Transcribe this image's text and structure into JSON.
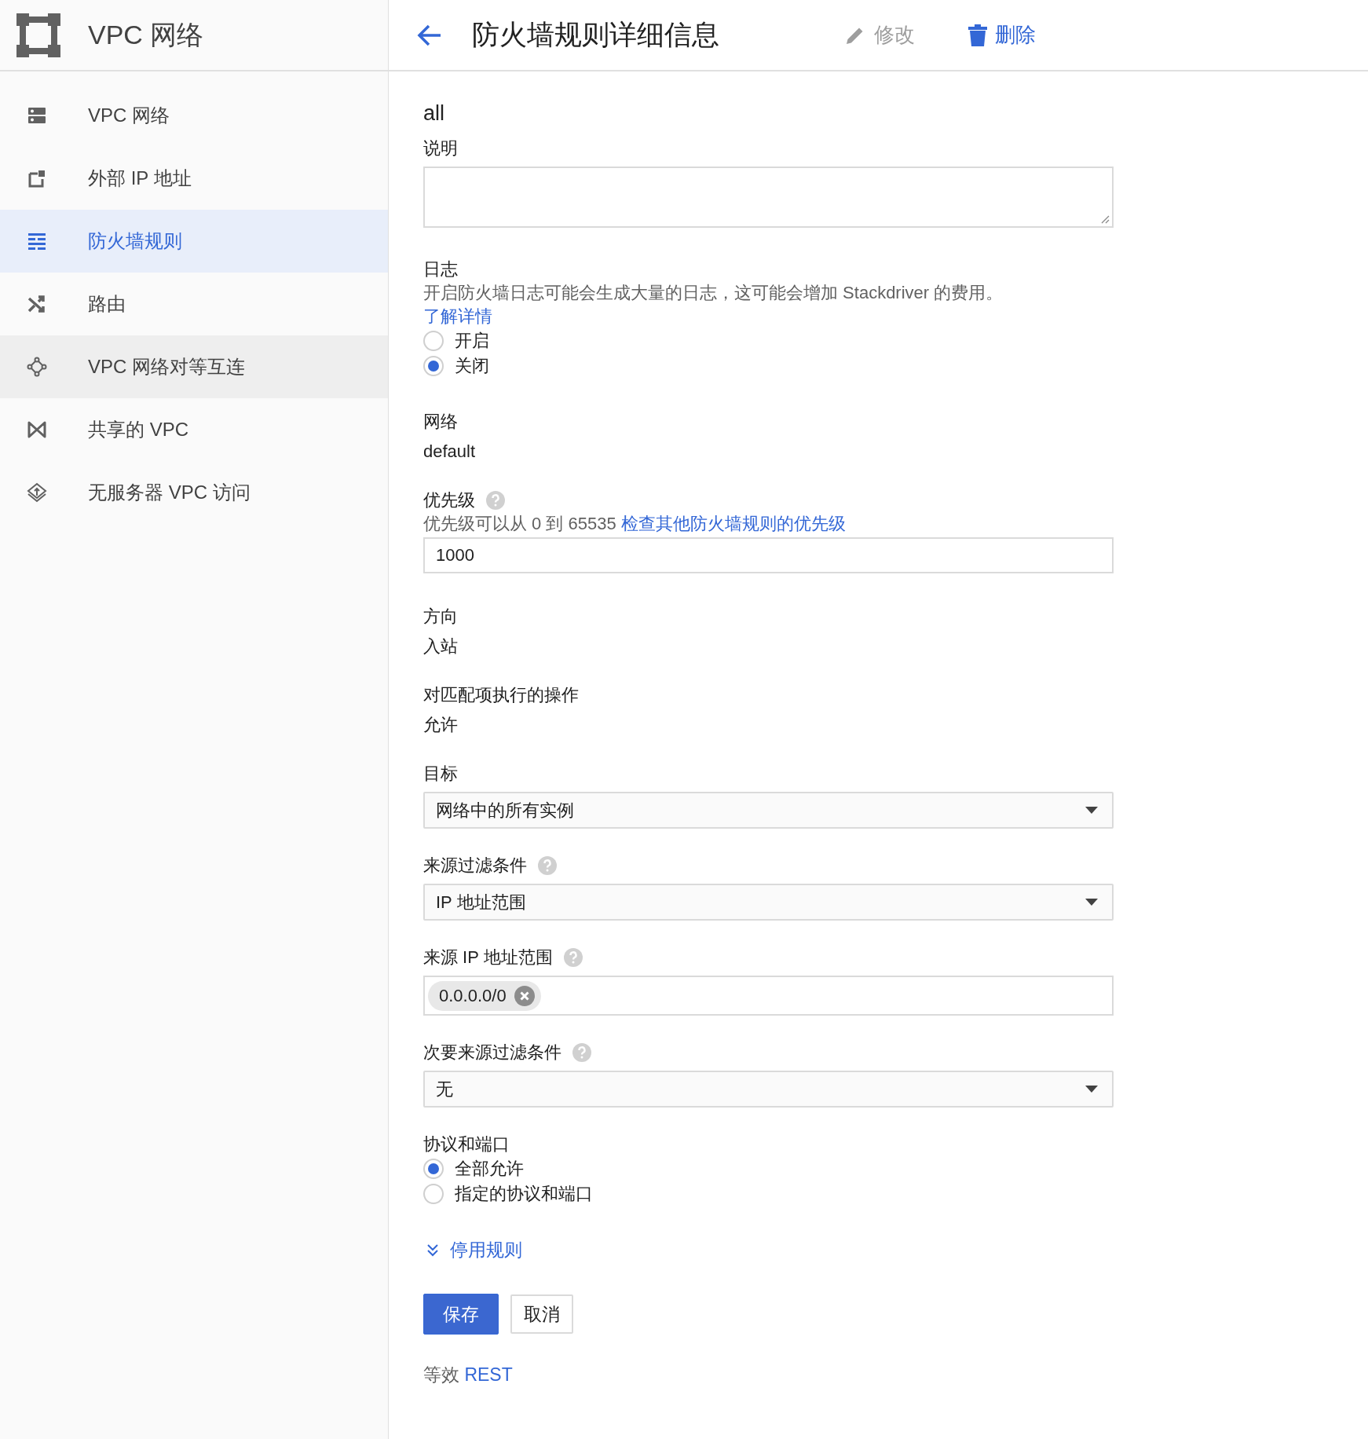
{
  "app_bar": {
    "title": "VPC 网络"
  },
  "sidebar": {
    "items": [
      {
        "label": "VPC 网络",
        "selected": false,
        "hovered": false
      },
      {
        "label": "外部 IP 地址",
        "selected": false,
        "hovered": false
      },
      {
        "label": "防火墙规则",
        "selected": true,
        "hovered": false
      },
      {
        "label": "路由",
        "selected": false,
        "hovered": false
      },
      {
        "label": "VPC 网络对等互连",
        "selected": false,
        "hovered": true
      },
      {
        "label": "共享的 VPC",
        "selected": false,
        "hovered": false
      },
      {
        "label": "无服务器 VPC 访问",
        "selected": false,
        "hovered": false
      }
    ]
  },
  "page_header": {
    "title": "防火墙规则详细信息",
    "actions": [
      {
        "kind": "edit",
        "label": "修改",
        "disabled": true
      },
      {
        "kind": "delete",
        "label": "删除",
        "disabled": false
      }
    ]
  },
  "form": {
    "rule_name": "all",
    "fields": [
      {
        "kind": "textarea",
        "label": "说明"
      },
      {
        "kind": "radio_group",
        "label": "日志",
        "description": "开启防火墙日志可能会生成大量的日志，这可能会增加 Stackdriver 的费用。",
        "link": "了解详情",
        "options": [
          {
            "label": "开启",
            "selected": false
          },
          {
            "label": "关闭",
            "selected": true
          }
        ]
      },
      {
        "kind": "text",
        "label": "网络",
        "value": "default"
      },
      {
        "kind": "input",
        "label": "优先级",
        "help": true,
        "description": "优先级可以从 0 到 65535",
        "link": "检查其他防火墙规则的优先级",
        "value": "1000"
      },
      {
        "kind": "text",
        "label": "方向",
        "value": "入站"
      },
      {
        "kind": "text",
        "label": "对匹配项执行的操作",
        "value": "允许"
      },
      {
        "kind": "select",
        "label": "目标",
        "value": "网络中的所有实例"
      },
      {
        "kind": "select",
        "label": "来源过滤条件",
        "help": true,
        "value": "IP 地址范围"
      },
      {
        "kind": "chips",
        "label": "来源 IP 地址范围",
        "help": true,
        "chips": [
          "0.0.0.0/0"
        ]
      },
      {
        "kind": "select",
        "label": "次要来源过滤条件",
        "help": true,
        "value": "无"
      },
      {
        "kind": "radio_group",
        "label": "协议和端口",
        "options": [
          {
            "label": "全部允许",
            "selected": true
          },
          {
            "label": "指定的协议和端口",
            "selected": false
          }
        ]
      }
    ],
    "toggle": {
      "label": "停用规则",
      "expanded": false
    },
    "buttons": [
      {
        "kind": "primary",
        "label": "保存"
      },
      {
        "kind": "secondary",
        "label": "取消"
      }
    ],
    "footer": {
      "text": "等效",
      "link": "REST"
    }
  }
}
